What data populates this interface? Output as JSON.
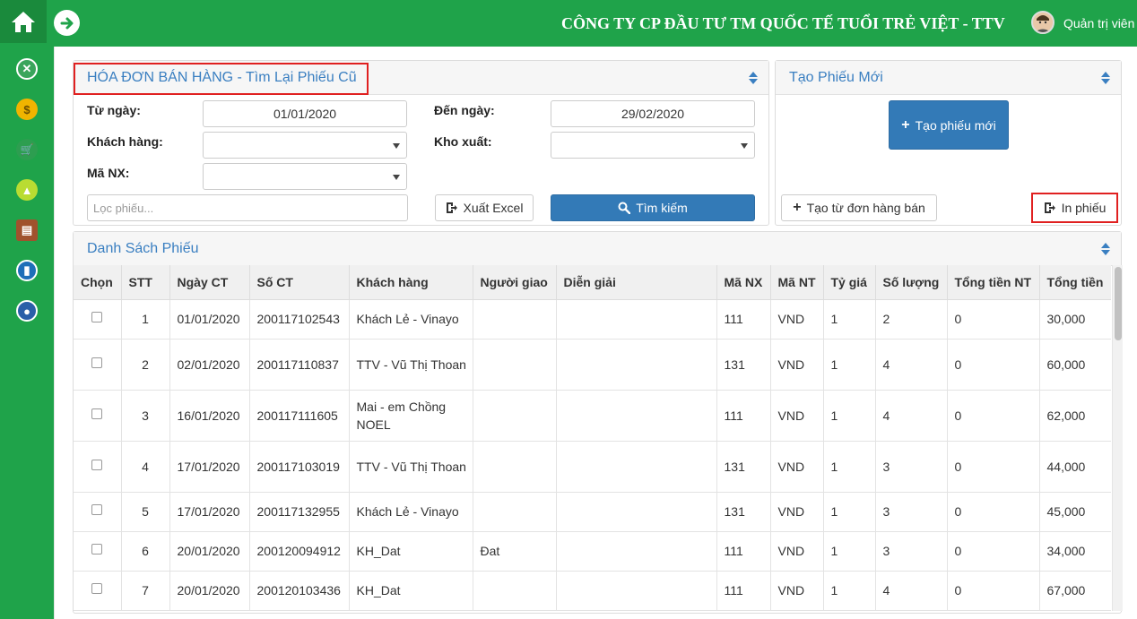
{
  "header": {
    "company": "CÔNG TY CP ĐẦU TƯ TM QUỐC TẾ TUỔI TRẺ VIỆT - TTV",
    "user": "Quản trị viên"
  },
  "sidebar": {
    "items": [
      "home-icon",
      "tools-icon",
      "money-bag-icon",
      "cart-icon",
      "shopping-bag-icon",
      "warehouse-icon",
      "chart-icon",
      "user-icon"
    ]
  },
  "search_panel": {
    "title": "HÓA ĐƠN BÁN HÀNG - Tìm Lại Phiếu Cũ",
    "from_date_label": "Từ ngày:",
    "from_date": "01/01/2020",
    "to_date_label": "Đến ngày:",
    "to_date": "29/02/2020",
    "customer_label": "Khách hàng:",
    "customer": "",
    "warehouse_label": "Kho xuất:",
    "warehouse": "",
    "code_label": "Mã NX:",
    "code": "",
    "filter_placeholder": "Lọc phiếu...",
    "excel_button": "Xuất Excel",
    "search_button": "Tìm kiếm"
  },
  "new_panel": {
    "title": "Tạo Phiếu Mới",
    "new_button": "Tạo phiếu mới",
    "from_order_button": "Tạo từ đơn hàng bán",
    "print_button": "In phiếu"
  },
  "list_panel": {
    "title": "Danh Sách Phiếu",
    "columns": [
      "Chọn",
      "STT",
      "Ngày CT",
      "Số CT",
      "Khách hàng",
      "Người giao",
      "Diễn giải",
      "Mã NX",
      "Mã NT",
      "Tỷ giá",
      "Số lượng",
      "Tổng tiền NT",
      "Tổng tiền"
    ],
    "rows": [
      {
        "stt": "1",
        "date": "01/01/2020",
        "no": "200117102543",
        "customer": "Khách Lẻ - Vinayo",
        "deliverer": "",
        "desc": "",
        "code": "111",
        "currency": "VND",
        "rate": "1",
        "qty": "2",
        "total_nt": "0",
        "total": "30,000"
      },
      {
        "stt": "2",
        "date": "02/01/2020",
        "no": "200117110837",
        "customer": "TTV - Vũ Thị Thoan",
        "deliverer": "",
        "desc": "",
        "code": "131",
        "currency": "VND",
        "rate": "1",
        "qty": "4",
        "total_nt": "0",
        "total": "60,000"
      },
      {
        "stt": "3",
        "date": "16/01/2020",
        "no": "200117111605",
        "customer": "Mai - em Chồng NOEL",
        "deliverer": "",
        "desc": "",
        "code": "111",
        "currency": "VND",
        "rate": "1",
        "qty": "4",
        "total_nt": "0",
        "total": "62,000"
      },
      {
        "stt": "4",
        "date": "17/01/2020",
        "no": "200117103019",
        "customer": "TTV - Vũ Thị Thoan",
        "deliverer": "",
        "desc": "",
        "code": "131",
        "currency": "VND",
        "rate": "1",
        "qty": "3",
        "total_nt": "0",
        "total": "44,000"
      },
      {
        "stt": "5",
        "date": "17/01/2020",
        "no": "200117132955",
        "customer": "Khách Lẻ - Vinayo",
        "deliverer": "",
        "desc": "",
        "code": "131",
        "currency": "VND",
        "rate": "1",
        "qty": "3",
        "total_nt": "0",
        "total": "45,000"
      },
      {
        "stt": "6",
        "date": "20/01/2020",
        "no": "200120094912",
        "customer": "KH_Dat",
        "deliverer": "Đat",
        "desc": "",
        "code": "111",
        "currency": "VND",
        "rate": "1",
        "qty": "3",
        "total_nt": "0",
        "total": "34,000"
      },
      {
        "stt": "7",
        "date": "20/01/2020",
        "no": "200120103436",
        "customer": "KH_Dat",
        "deliverer": "",
        "desc": "",
        "code": "111",
        "currency": "VND",
        "rate": "1",
        "qty": "4",
        "total_nt": "0",
        "total": "67,000"
      }
    ]
  },
  "colors": {
    "brand_green": "#1fa34a",
    "accent_blue": "#337ab7",
    "highlight_red": "#e02020"
  }
}
